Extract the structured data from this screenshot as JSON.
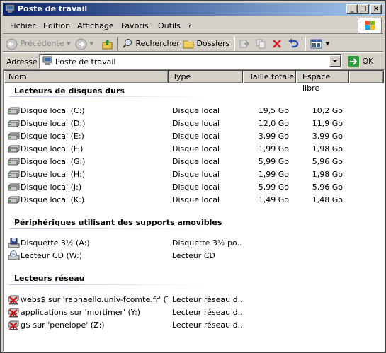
{
  "window": {
    "title": "Poste de travail"
  },
  "menu": [
    "Fichier",
    "Edition",
    "Affichage",
    "Favoris",
    "Outils",
    "?"
  ],
  "toolbar": {
    "back": "Précédente",
    "search": "Rechercher",
    "folders": "Dossiers"
  },
  "address": {
    "label": "Adresse",
    "value": "Poste de travail",
    "go": "OK"
  },
  "columns": {
    "name": "Nom",
    "type": "Type",
    "total": "Taille totale",
    "free": "Espace libre"
  },
  "groups": {
    "hdd": "Lecteurs de disques durs",
    "removable": "Périphériques utilisant des supports amovibles",
    "network": "Lecteurs réseau"
  },
  "hdd": [
    {
      "name": "Disque local (C:)",
      "type": "Disque local",
      "total": "19,5 Go",
      "free": "10,2 Go"
    },
    {
      "name": "Disque local (D:)",
      "type": "Disque local",
      "total": "12,0 Go",
      "free": "11,9 Go"
    },
    {
      "name": "Disque local (E:)",
      "type": "Disque local",
      "total": "3,99 Go",
      "free": "3,99 Go"
    },
    {
      "name": "Disque local (F:)",
      "type": "Disque local",
      "total": "1,99 Go",
      "free": "1,98 Go"
    },
    {
      "name": "Disque local (G:)",
      "type": "Disque local",
      "total": "5,99 Go",
      "free": "5,96 Go"
    },
    {
      "name": "Disque local (H:)",
      "type": "Disque local",
      "total": "1,99 Go",
      "free": "1,98 Go"
    },
    {
      "name": "Disque local (J:)",
      "type": "Disque local",
      "total": "5,99 Go",
      "free": "5,96 Go"
    },
    {
      "name": "Disque local (K:)",
      "type": "Disque local",
      "total": "1,49 Go",
      "free": "1,48 Go"
    }
  ],
  "removable": [
    {
      "name": "Disquette 3½ (A:)",
      "type": "Disquette 3½ po...",
      "icon": "floppy-icon"
    },
    {
      "name": "Lecteur CD (W:)",
      "type": "Lecteur CD",
      "icon": "cd-drive-icon"
    }
  ],
  "network": [
    {
      "name": "webs$ sur 'raphaello.univ-fcomte.fr' (T:)",
      "type": "Lecteur réseau d..."
    },
    {
      "name": "applications sur 'mortimer' (Y:)",
      "type": "Lecteur réseau d..."
    },
    {
      "name": "g$ sur 'penelope' (Z:)",
      "type": "Lecteur réseau d..."
    }
  ]
}
